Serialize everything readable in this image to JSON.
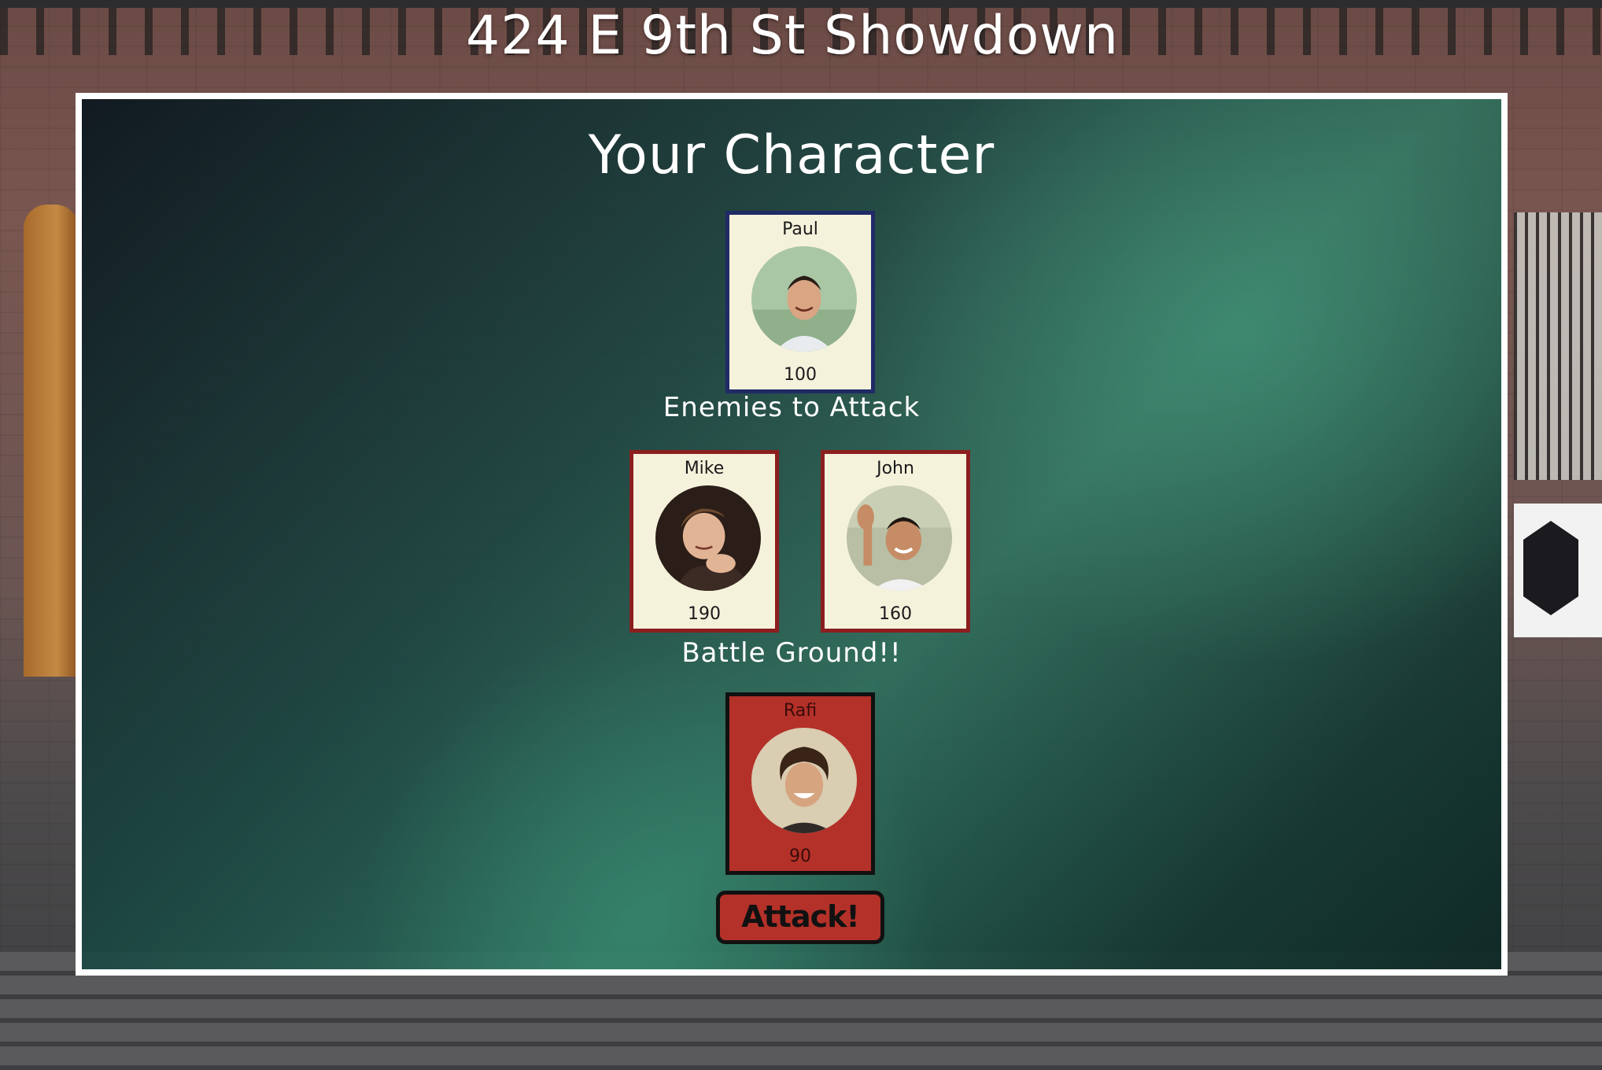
{
  "page": {
    "title": "424 E 9th St Showdown"
  },
  "sections": {
    "your_character": "Your Character",
    "enemies": "Enemies to Attack",
    "battle": "Battle Ground!!"
  },
  "player": {
    "name": "Paul",
    "hp": "100"
  },
  "enemies": [
    {
      "name": "Mike",
      "hp": "190"
    },
    {
      "name": "John",
      "hp": "160"
    }
  ],
  "defender": {
    "name": "Rafi",
    "hp": "90"
  },
  "actions": {
    "attack_label": "Attack!"
  },
  "colors": {
    "panel_border": "#ffffff",
    "card_bg": "#f5f2dc",
    "player_border": "#1f2a66",
    "enemy_border": "#8b1e1e",
    "defender_bg": "#b33129",
    "attack_button_bg": "#b33129"
  }
}
